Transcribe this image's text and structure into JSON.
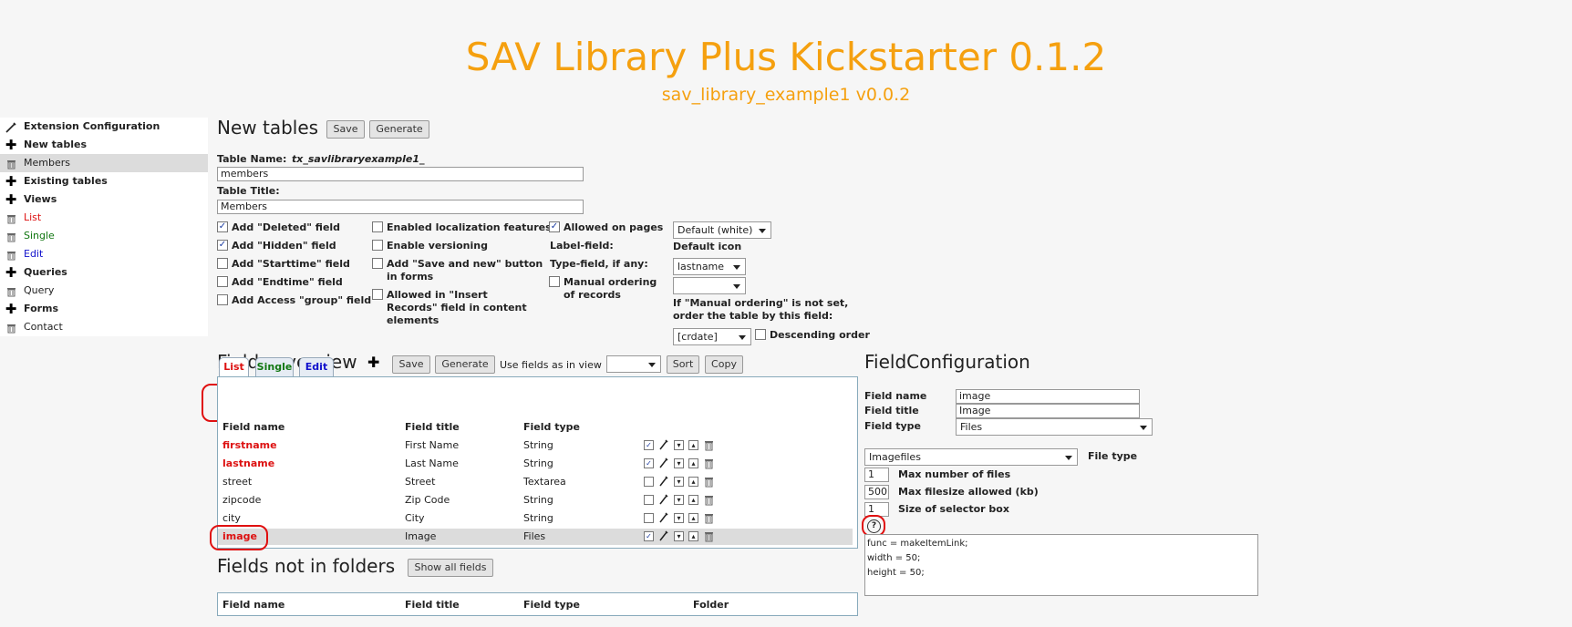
{
  "header": {
    "title": "SAV Library Plus Kickstarter 0.1.2",
    "subtitle": "sav_library_example1 v0.0.2"
  },
  "sidebar": {
    "items": [
      {
        "label": "Extension Configuration",
        "icon": "pen-icon"
      },
      {
        "label": "New tables",
        "icon": "plus-icon"
      },
      {
        "label": "Members",
        "icon": "trash-icon"
      },
      {
        "label": "Existing tables",
        "icon": "plus-icon"
      },
      {
        "label": "Views",
        "icon": "plus-icon"
      },
      {
        "label": "List",
        "icon": "trash-icon",
        "color": "#dd1111"
      },
      {
        "label": "Single",
        "icon": "trash-icon",
        "color": "#117711"
      },
      {
        "label": "Edit",
        "icon": "trash-icon",
        "color": "#1111cc"
      },
      {
        "label": "Queries",
        "icon": "plus-icon"
      },
      {
        "label": "Query",
        "icon": "trash-icon"
      },
      {
        "label": "Forms",
        "icon": "plus-icon"
      },
      {
        "label": "Contact",
        "icon": "trash-icon"
      }
    ]
  },
  "new_tables": {
    "heading": "New tables",
    "save_label": "Save",
    "generate_label": "Generate",
    "table_name_label": "Table Name:",
    "table_name_prefix": "tx_savlibraryexample1_",
    "table_name_value": "members",
    "table_title_label": "Table Title:",
    "table_title_value": "Members",
    "options_col1": [
      {
        "label": "Add \"Deleted\" field",
        "checked": "✓"
      },
      {
        "label": "Add \"Hidden\" field",
        "checked": "✓"
      },
      {
        "label": "Add \"Starttime\" field",
        "checked": ""
      },
      {
        "label": "Add \"Endtime\" field",
        "checked": ""
      },
      {
        "label": "Add Access \"group\" field",
        "checked": ""
      }
    ],
    "options_col2": [
      {
        "label": "Enabled localization features",
        "checked": ""
      },
      {
        "label": "Enable versioning",
        "checked": ""
      },
      {
        "label": "Add \"Save and new\" button in forms",
        "checked": ""
      },
      {
        "label": "Allowed in \"Insert Records\" field in content elements",
        "checked": ""
      }
    ],
    "allowed_on_pages_label": "Allowed on pages",
    "allowed_on_pages_checked": "✓",
    "label_field_label": "Label-field:",
    "type_field_label": "Type-field, if any:",
    "manual_ordering_label": "Manual ordering of records",
    "manual_ordering_checked": "",
    "default_icon_select": "Default (white)",
    "default_icon_label": "Default icon",
    "label_field_select": "lastname",
    "type_field_select": "",
    "ordering_note": "If \"Manual ordering\" is not set, order the table by this field:",
    "ordering_select": "[crdate]",
    "descending_label": "Descending order",
    "descending_checked": ""
  },
  "fields_overview": {
    "heading": "Fields overview",
    "add_icon": "plus-icon",
    "save_label": "Save",
    "generate_label": "Generate",
    "use_fields_label": "Use fields as in view",
    "use_fields_select": "",
    "sort_label": "Sort",
    "copy_label": "Copy",
    "tabs": [
      {
        "label": "List",
        "color": "#dd1111",
        "active": true
      },
      {
        "label": "Single",
        "color": "#117711"
      },
      {
        "label": "Edit",
        "color": "#1111cc"
      }
    ],
    "columns": [
      "Field name",
      "Field title",
      "Field type"
    ],
    "rows": [
      {
        "name": "firstname",
        "title": "First Name",
        "type": "String",
        "checked": "✓",
        "name_style": "red-bold"
      },
      {
        "name": "lastname",
        "title": "Last Name",
        "type": "String",
        "checked": "✓",
        "name_style": "red-bold"
      },
      {
        "name": "street",
        "title": "Street",
        "type": "Textarea",
        "checked": "",
        "name_style": "normal"
      },
      {
        "name": "zipcode",
        "title": "Zip Code",
        "type": "String",
        "checked": "",
        "name_style": "normal"
      },
      {
        "name": "city",
        "title": "City",
        "type": "String",
        "checked": "",
        "name_style": "normal"
      },
      {
        "name": "image",
        "title": "Image",
        "type": "Files",
        "checked": "✓",
        "name_style": "red-bold",
        "selected": true
      }
    ]
  },
  "fields_not_in_folders": {
    "heading": "Fields not in folders",
    "show_all_label": "Show all fields",
    "columns": [
      "Field name",
      "Field title",
      "Field type",
      "Folder"
    ]
  },
  "field_configuration": {
    "heading": "FieldConfiguration",
    "field_name_label": "Field name",
    "field_name_value": "image",
    "field_title_label": "Field title",
    "field_title_value": "Image",
    "field_type_label": "Field type",
    "field_type_select": "Files",
    "file_type_select": "Imagefiles",
    "file_type_label": "File type",
    "max_files_value": "1",
    "max_files_label": "Max number of files",
    "max_filesize_value": "500",
    "max_filesize_label": "Max filesize allowed (kb)",
    "selector_size_value": "1",
    "selector_size_label": "Size of selector box",
    "help_icon": "help-icon",
    "config_text": "func = makeItemLink;\nwidth = 50;\nheight = 50;"
  }
}
